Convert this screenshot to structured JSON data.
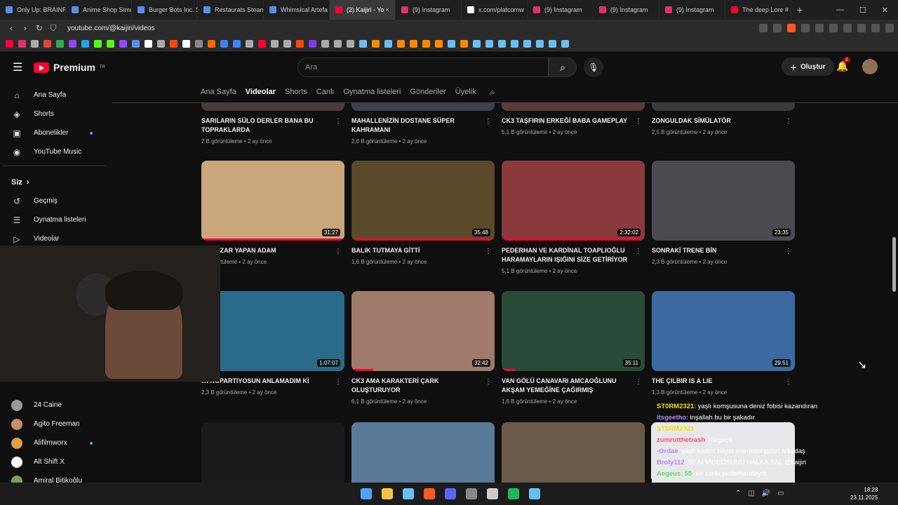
{
  "browser_tabs": [
    {
      "title": "Only Up: BRAINR",
      "color": "#5b8def"
    },
    {
      "title": "Anime Shop Simu",
      "color": "#5b8def"
    },
    {
      "title": "Burger Bots Inc. S",
      "color": "#5b8def"
    },
    {
      "title": "Restaurats Steam",
      "color": "#5b8def"
    },
    {
      "title": "Whimsical Artefa",
      "color": "#5b8def"
    },
    {
      "title": "(2) Kaijiri - Yo",
      "color": "#ff0033",
      "active": true
    },
    {
      "title": "(9) Instagram",
      "color": "#e1306c"
    },
    {
      "title": "x.com/platcornw",
      "color": "#ffffff"
    },
    {
      "title": "(9) Instagram",
      "color": "#e1306c"
    },
    {
      "title": "(9) Instagram",
      "color": "#e1306c"
    },
    {
      "title": "(9) Instagram",
      "color": "#e1306c"
    },
    {
      "title": "The deep Lore #",
      "color": "#ff0033"
    }
  ],
  "address": {
    "url": "youtube.com/@kaijiri/videos"
  },
  "header": {
    "logo_text": "Premium",
    "logo_sup": "TR",
    "search_placeholder": "Ara",
    "create_label": "Oluştur",
    "notif_count": "2"
  },
  "sidebar": {
    "main": [
      {
        "label": "Ana Sayfa",
        "icon": "home-icon",
        "glyph": "⌂"
      },
      {
        "label": "Shorts",
        "icon": "shorts-icon",
        "glyph": "◈"
      },
      {
        "label": "Abonelikler",
        "icon": "subscriptions-icon",
        "glyph": "▣",
        "dot": true
      },
      {
        "label": "YouTube Music",
        "icon": "music-icon",
        "glyph": "◉"
      }
    ],
    "you_heading": "Siz",
    "you": [
      {
        "label": "Geçmiş",
        "icon": "history-icon",
        "glyph": "↺"
      },
      {
        "label": "Oynatma listeleri",
        "icon": "playlist-icon",
        "glyph": "☰"
      },
      {
        "label": "Videolar",
        "icon": "video-icon",
        "glyph": "▷"
      }
    ],
    "channels": [
      {
        "label": "24 Caine",
        "color": "#999999"
      },
      {
        "label": "Agito Freeman",
        "color": "#c98d6a"
      },
      {
        "label": "Alifilmworx",
        "color": "#e0a040",
        "dot": true
      },
      {
        "label": "Alt Shift X",
        "color": "#ffffff"
      },
      {
        "label": "Amiral Bitikoğlu",
        "color": "#7aa05a"
      }
    ]
  },
  "channel_tabs": [
    "Ana Sayfa",
    "Videolar",
    "Shorts",
    "Canlı",
    "Oynatma listeleri",
    "Gönderiler",
    "Üyelik"
  ],
  "videos": [
    {
      "title": "SARILARIN SÜLO DERLER BANA BU TOPRAKLARDA",
      "views": "2 B görüntüleme",
      "age": "2 ay önce",
      "duration": "",
      "color": "#4a3a3a"
    },
    {
      "title": "MAHALLENİZİN DOSTANE SÜPER KAHRAMANI",
      "views": "2,6 B görüntüleme",
      "age": "2 ay önce",
      "duration": "",
      "color": "#3a4050"
    },
    {
      "title": "CK3 TAŞFIRIN ERKEĞİ BABA GAMEPLAY",
      "views": "5,1 B görüntüleme",
      "age": "2 ay önce",
      "duration": "",
      "color": "#5a3a3a"
    },
    {
      "title": "ZONGULDAK SİMÜLATÖR",
      "views": "2,5 B görüntüleme",
      "age": "2 ay önce",
      "duration": "",
      "color": "#3a3a3a"
    },
    {
      "title": "...'I SEZAR YAPAN ADAM",
      "views": "...görüntüleme",
      "age": "2 ay önce",
      "duration": "31:27",
      "color": "#c9a77a",
      "progress": 1.0
    },
    {
      "title": "BALIK TUTMAYA GİTTİ",
      "views": "1,6 B görüntüleme",
      "age": "2 ay önce",
      "duration": "35:48",
      "color": "#5a4a2a",
      "progress": 1.0
    },
    {
      "title": "PEDERHAN VE KARDİNAL TOAPLIOĞLU HARAMAYLARIN IŞIĞINI SİZE GETİRİYOR",
      "views": "5,1 B görüntüleme",
      "age": "2 ay önce",
      "duration": "2:32:02",
      "color": "#8a3a3a",
      "progress": 1.0
    },
    {
      "title": "SONRAKİ TRENE BİN",
      "views": "2,3 B görüntüleme",
      "age": "2 ay önce",
      "duration": "23:35",
      "color": "#4a4a50",
      "progress": 0
    },
    {
      "title": "...I KOPARTIYOSUN ANLAMADIM Kİ",
      "views": "2,3 B görüntüleme",
      "age": "2 ay önce",
      "duration": "1:07:07",
      "color": "#2a6a8a",
      "progress": 0
    },
    {
      "title": "CK3 AMA KARAKTERİ ÇARK OLUŞTURUYOR",
      "views": "6,1 B görüntüleme",
      "age": "2 ay önce",
      "duration": "32:42",
      "color": "#a07a6a",
      "progress": 0.15
    },
    {
      "title": "VAN GÖLÜ CANAVARI AMCAOĞLUNU AKŞAM YEMEĞİNE ÇAĞIRMIŞ",
      "views": "1,6 B görüntüleme",
      "age": "2 ay önce",
      "duration": "35:11",
      "color": "#2a4a3a",
      "progress": 0.1
    },
    {
      "title": "THE ÇILBIR IS A LIE",
      "views": "1,3 B görüntüleme",
      "age": "2 ay önce",
      "duration": "29:51",
      "color": "#3a6aa0",
      "progress": 0
    },
    {
      "title": "",
      "views": "",
      "age": "",
      "duration": "",
      "color": "#1a1a1a"
    },
    {
      "title": "",
      "views": "",
      "age": "",
      "duration": "",
      "color": "#5a7a9a"
    },
    {
      "title": "",
      "views": "",
      "age": "",
      "duration": "",
      "color": "#6a5a4a"
    },
    {
      "title": "",
      "views": "",
      "age": "",
      "duration": "",
      "color": "#e8e8ea"
    }
  ],
  "chat": [
    {
      "user": "ST0RM2321",
      "msg": ": yaşlı komşusuna deniz fobisi kazandıran",
      "ucolor": "#f0e100"
    },
    {
      "user": "itsgeetho",
      "msg": ": inşallah bu bir şakadır",
      "ucolor": "#b388ff"
    },
    {
      "user": "ST0RM2321",
      "msg": ":",
      "ucolor": "#f0e100"
    },
    {
      "user": "zumrutthetrash",
      "msg": ": kürgeçti",
      "ucolor": "#ff4d6a"
    },
    {
      "user": "-Ordae",
      "msg": ": yaşlı kadını hayat enerjisini çalan arkadaş",
      "ucolor": "#b388ff"
    },
    {
      "user": "Broly112",
      "msg": ": 50 AI VİDEOSUNU HALKA SAL @kaijiri",
      "ucolor": "#b388ff"
    },
    {
      "user": "Aegeus_55",
      "msg": ": en sonki pederhandaydı",
      "ucolor": "#5dde5d"
    }
  ],
  "taskbar": {
    "time": "18:28",
    "date": "23.11.2025"
  },
  "bookmark_colors": [
    "#ff0033",
    "#e1306c",
    "#aaaaaa",
    "#ea4335",
    "#34a853",
    "#9146ff",
    "#1da1f2",
    "#53fc18",
    "#53fc18",
    "#9146ff",
    "#5b8def",
    "#ffffff",
    "#aaaaaa",
    "#ff4500",
    "#ffffff",
    "#888888",
    "#ff6600",
    "#3b82f6",
    "#3b82f6",
    "#aaaaaa",
    "#ff0033",
    "#aaaaaa",
    "#aaaaaa",
    "#ff4500",
    "#7c3aed",
    "#aaaaaa",
    "#aaaaaa",
    "#aaaaaa",
    "#66c0f4",
    "#ff8800",
    "#66c0f4",
    "#ff8800",
    "#ff8800",
    "#ff8800",
    "#ff8800",
    "#66c0f4",
    "#ff8800",
    "#66c0f4",
    "#66c0f4",
    "#66c0f4",
    "#66c0f4",
    "#66c0f4",
    "#66c0f4",
    "#66c0f4",
    "#66c0f4"
  ],
  "taskbar_icon_colors": [
    "#4fa3ff",
    "#f5c242",
    "#66c0f4",
    "#ff5722",
    "#5865f2",
    "#888888",
    "#cccccc",
    "#1db954",
    "#66c0f4"
  ]
}
